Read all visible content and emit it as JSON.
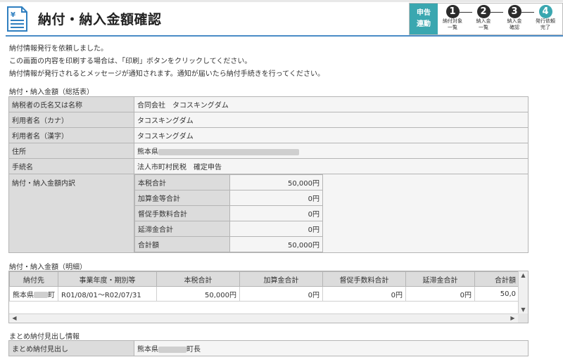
{
  "header": {
    "title": "納付・納入金額確認",
    "doc_icon": "document-yen-icon"
  },
  "steps": {
    "tag_line1": "申告",
    "tag_line2": "連動",
    "items": [
      {
        "num": "1",
        "label1": "納付対象",
        "label2": "一覧"
      },
      {
        "num": "2",
        "label1": "納入金",
        "label2": "一覧"
      },
      {
        "num": "3",
        "label1": "納入金",
        "label2": "確認"
      },
      {
        "num": "4",
        "label1": "発行依頼",
        "label2": "完了"
      }
    ],
    "active_color": "#3aa7b0"
  },
  "messages": [
    "納付情報発行を依頼しました。",
    "この画面の内容を印刷する場合は、「印刷」ボタンをクリックしてください。",
    "納付情報が発行されるとメッセージが通知されます。通知が届いたら納付手続きを行ってください。"
  ],
  "summary": {
    "section_title": "納付・納入金額（総括表）",
    "rows": [
      {
        "label": "納税者の氏名又は名称",
        "value": "合同会社　タコスキングダム"
      },
      {
        "label": "利用者名（カナ）",
        "value": "タコスキングダム"
      },
      {
        "label": "利用者名（漢字）",
        "value": "タコスキングダム"
      },
      {
        "label": "住所",
        "value": "熊本県"
      },
      {
        "label": "手続名",
        "value": "法人市町村民税　確定申告"
      }
    ],
    "breakdown_label": "納付・納入金額内訳",
    "breakdown": [
      {
        "label": "本税合計",
        "value": "50,000円"
      },
      {
        "label": "加算金等合計",
        "value": "0円"
      },
      {
        "label": "督促手数料合計",
        "value": "0円"
      },
      {
        "label": "延滞金合計",
        "value": "0円"
      },
      {
        "label": "合計額",
        "value": "50,000円"
      }
    ]
  },
  "detail": {
    "section_title": "納付・納入金額（明細）",
    "columns": [
      "納付先",
      "事業年度・期別等",
      "本税合計",
      "加算金合計",
      "督促手数料合計",
      "延滞金合計",
      "合計額"
    ],
    "rows": [
      {
        "payee_prefix": "熊本県",
        "payee_suffix": "町",
        "period": "R01/08/01～R02/07/31",
        "tax": "50,000円",
        "addition": "0円",
        "fee": "0円",
        "delinquency": "0円",
        "total": "50,0"
      }
    ]
  },
  "matome": {
    "section_title": "まとめ納付見出し情報",
    "label": "まとめ納付見出し",
    "value_prefix": "熊本県",
    "value_suffix": "町長"
  }
}
